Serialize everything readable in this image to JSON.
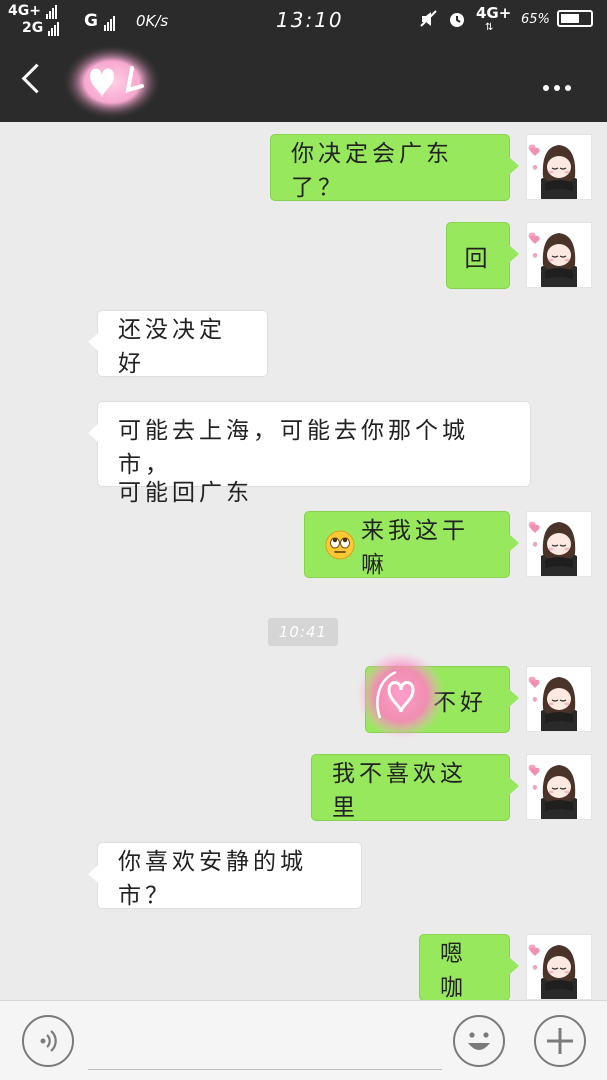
{
  "status_bar": {
    "network_left_1": "4G+",
    "network_left_2": "2G",
    "network_g": "G",
    "speed": "0K/s",
    "time": "13:10",
    "network_right": "4G+",
    "battery_percent": "65%",
    "battery_level": 0.65
  },
  "header": {
    "back_icon": "chevron-left-icon",
    "more_icon": "more-dots-icon"
  },
  "messages": [
    {
      "side": "out",
      "text": "你决定会广东了？"
    },
    {
      "side": "out",
      "text": "回"
    },
    {
      "side": "in",
      "text": "还没决定好"
    },
    {
      "side": "in",
      "line1": "可能去上海，可能去你那个城市，",
      "line2": "可能回广东"
    },
    {
      "side": "out",
      "text": "来我这干嘛",
      "emoji": "eye-roll-emoji"
    },
    {
      "side": "out",
      "text": "不好",
      "sticker": "heart-sticker"
    },
    {
      "side": "out",
      "text": "我不喜欢这里"
    },
    {
      "side": "in",
      "text": "你喜欢安静的城市？"
    },
    {
      "side": "out",
      "text": "嗯咖"
    }
  ],
  "timestamp": "10:41",
  "input_bar": {
    "voice_icon": "voice-icon",
    "input_value": "",
    "emoji_icon": "smiley-icon",
    "plus_icon": "plus-icon"
  },
  "colors": {
    "bar_background": "#2b2b2b",
    "chat_background": "#ebebeb",
    "outgoing_bubble": "#97e85c",
    "incoming_bubble": "#ffffff"
  }
}
